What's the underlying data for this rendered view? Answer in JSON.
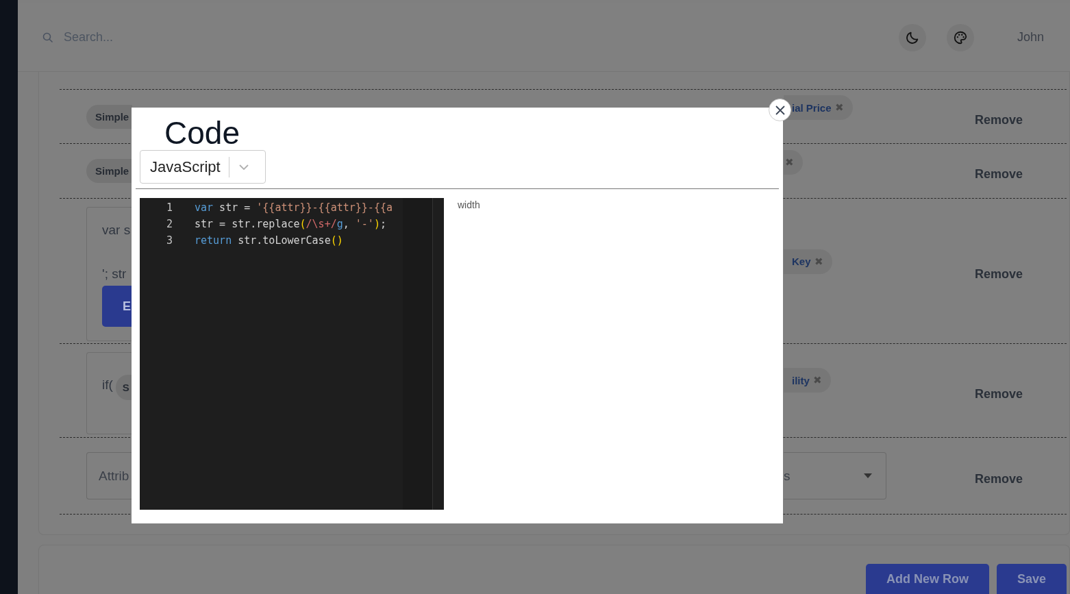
{
  "header": {
    "search": {
      "placeholder": "Search..."
    },
    "user": "John"
  },
  "rows": [
    {
      "left": {
        "kind": "chip",
        "label": "Simple"
      },
      "right": {
        "kind": "chip",
        "label": "ial Price",
        "close": "✖"
      },
      "action": "Remove"
    },
    {
      "left": {
        "kind": "chip",
        "label": "Simple"
      },
      "right": {
        "kind": "chip",
        "close": "✖"
      },
      "action": "Remove"
    },
    {
      "left": {
        "kind": "code",
        "lines": [
          "var s",
          "'; str"
        ],
        "button": "E"
      },
      "right": {
        "kind": "chip",
        "label": "Key",
        "close": "✖"
      },
      "action": "Remove"
    },
    {
      "left": {
        "kind": "code",
        "lines": [
          "if("
        ],
        "chip": "S"
      },
      "right": {
        "kind": "chip",
        "label": "ility",
        "close": "✖"
      },
      "action": "Remove"
    },
    {
      "left": {
        "kind": "select",
        "value": "Attrib"
      },
      "right": {
        "kind": "select",
        "value": "s"
      },
      "action": "Remove"
    }
  ],
  "footer": {
    "buttons": [
      "Add New Row",
      "Save"
    ]
  },
  "modal": {
    "title": "Code",
    "language": "JavaScript",
    "side_label": "width",
    "editor": {
      "lines": [
        {
          "number": "1",
          "tokens": [
            {
              "color": "#569cd6",
              "text": "var"
            },
            {
              "color": "#d4d4d4",
              "text": " str = "
            },
            {
              "color": "#ce9178",
              "text": "'{{attr}}-{{attr}}-{{a"
            }
          ]
        },
        {
          "number": "2",
          "tokens": [
            {
              "color": "#d4d4d4",
              "text": "str = str.replace"
            },
            {
              "color": "#ffd700",
              "text": "("
            },
            {
              "color": "#d16969",
              "text": "/\\s+/"
            },
            {
              "color": "#569cd6",
              "text": "g"
            },
            {
              "color": "#d4d4d4",
              "text": ", "
            },
            {
              "color": "#ce9178",
              "text": "'-'"
            },
            {
              "color": "#ffd700",
              "text": ")"
            },
            {
              "color": "#d4d4d4",
              "text": ";"
            }
          ]
        },
        {
          "number": "3",
          "tokens": [
            {
              "color": "#569cd6",
              "text": "return"
            },
            {
              "color": "#d4d4d4",
              "text": " str.toLowerCase"
            },
            {
              "color": "#ffd700",
              "text": "()"
            }
          ]
        }
      ]
    }
  }
}
